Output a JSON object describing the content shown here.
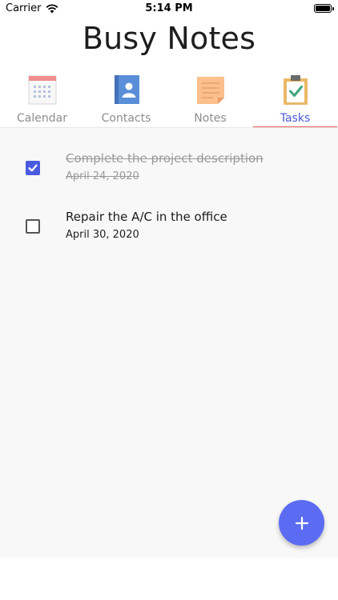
{
  "status": {
    "carrier": "Carrier",
    "time": "5:14 PM"
  },
  "app": {
    "title": "Busy Notes"
  },
  "tabs": [
    {
      "label": "Calendar",
      "icon": "calendar-icon",
      "active": false
    },
    {
      "label": "Contacts",
      "icon": "contacts-book-icon",
      "active": false
    },
    {
      "label": "Notes",
      "icon": "sticky-note-icon",
      "active": false
    },
    {
      "label": "Tasks",
      "icon": "clipboard-check-icon",
      "active": true
    }
  ],
  "tasks": [
    {
      "title": "Complete the project description",
      "date": "April 24, 2020",
      "done": true
    },
    {
      "title": "Repair the A/C in the office",
      "date": "April 30, 2020",
      "done": false
    }
  ],
  "colors": {
    "accent": "#5b6cf3",
    "active_tab": "#4a5ad8",
    "tab_underline": "#e85b5b"
  }
}
